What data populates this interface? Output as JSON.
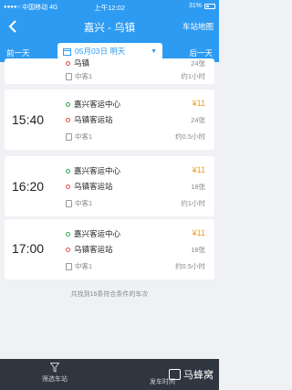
{
  "status": {
    "carrier": "中国移动",
    "network": "4G",
    "time": "上午12:02",
    "battery": "31%"
  },
  "nav": {
    "title": "嘉兴 - 乌镇",
    "map_label": "车站地图"
  },
  "datebar": {
    "prev_label": "前一天",
    "date_label": "05月03日 明天",
    "next_label": "后一天"
  },
  "trips": [
    {
      "time": "",
      "from": "",
      "to": "乌镇",
      "price": "",
      "seats": "24张",
      "bus": "中客1",
      "duration": "约1小时"
    },
    {
      "time": "15:40",
      "from": "嘉兴客运中心",
      "to": "乌镇客运站",
      "price": "¥11",
      "seats": "24张",
      "bus": "中客1",
      "duration": "约0.5小时"
    },
    {
      "time": "16:20",
      "from": "嘉兴客运中心",
      "to": "乌镇客运站",
      "price": "¥11",
      "seats": "18张",
      "bus": "中客1",
      "duration": "约1小时"
    },
    {
      "time": "17:00",
      "from": "嘉兴客运中心",
      "to": "乌镇客运站",
      "price": "¥11",
      "seats": "18张",
      "bus": "中客1",
      "duration": "约0.5小时"
    }
  ],
  "found_text": "共找到16条符合条件的车次",
  "bottom": {
    "filter_label": "筛选车站",
    "depart_label": "发车时间",
    "watermark": "马蜂窝"
  }
}
